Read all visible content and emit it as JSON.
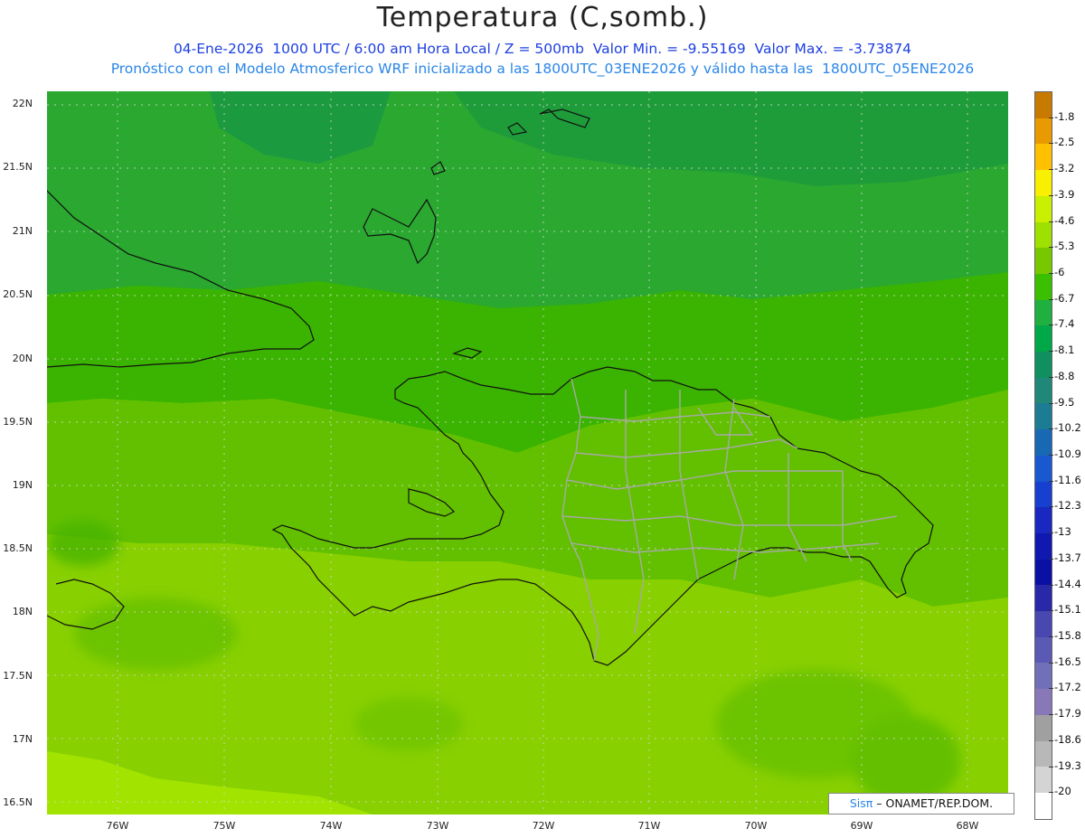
{
  "header": {
    "title": "Temperatura (C,somb.)",
    "line1": "04-Ene-2026  1000 UTC / 6:00 am Hora Local / Z = 500mb  Valor Min. = -9.55169  Valor Max. = -3.73874",
    "line2": "Pronóstico con el Modelo Atmosferico WRF inicializado a las 1800UTC_03ENE2026 y válido hasta las  1800UTC_05ENE2026"
  },
  "axes": {
    "lat_labels": [
      "22N",
      "21.5N",
      "21N",
      "20.5N",
      "20N",
      "19.5N",
      "19N",
      "18.5N",
      "18N",
      "17.5N",
      "17N",
      "16.5N"
    ],
    "lon_labels": [
      "76W",
      "75W",
      "74W",
      "73W",
      "72W",
      "71W",
      "70W",
      "69W",
      "68W"
    ]
  },
  "colorbar": {
    "labels": [
      "-1.8",
      "-2.5",
      "-3.2",
      "-3.9",
      "-4.6",
      "-5.3",
      "-6",
      "-6.7",
      "-7.4",
      "-8.1",
      "-8.8",
      "-9.5",
      "-10.2",
      "-10.9",
      "-11.6",
      "-12.3",
      "-13",
      "-13.7",
      "-14.4",
      "-15.1",
      "-15.8",
      "-16.5",
      "-17.2",
      "-17.9",
      "-18.6",
      "-19.3",
      "-20"
    ],
    "colors": [
      "#c87a00",
      "#e89a00",
      "#ffc000",
      "#f8f000",
      "#c8f000",
      "#9ee000",
      "#78c800",
      "#3ac000",
      "#20b040",
      "#00a848",
      "#109060",
      "#208878",
      "#1c7c94",
      "#1868b4",
      "#1a58d0",
      "#1840d0",
      "#1828c0",
      "#1018b0",
      "#0a10a4",
      "#2828a8",
      "#4848b0",
      "#5a5ab4",
      "#7070b8",
      "#8878b8",
      "#a0a0a0",
      "#b8b8b8",
      "#d4d4d4",
      "#ffffff"
    ]
  },
  "credit": {
    "brand": "Sisπ",
    "text": " – ONAMET/REP.DOM."
  }
}
